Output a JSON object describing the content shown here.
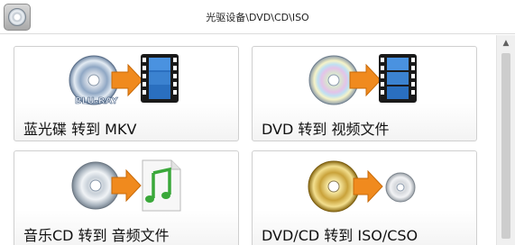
{
  "window": {
    "title": "光驱设备\\DVD\\CD\\ISO"
  },
  "cards": [
    {
      "label": "蓝光碟 转到 MKV",
      "source_icon": "bluray-disc-icon",
      "target_icon": "film-strip-icon",
      "source_badge": "BLU-RAY"
    },
    {
      "label": "DVD 转到 视频文件",
      "source_icon": "dvd-disc-icon",
      "target_icon": "film-strip-icon"
    },
    {
      "label": "音乐CD 转到 音频文件",
      "source_icon": "cd-disc-icon",
      "target_icon": "music-file-icon"
    },
    {
      "label": "DVD/CD 转到 ISO/CSO",
      "source_icon": "gold-disc-icon",
      "target_icon": "iso-disc-icon"
    }
  ],
  "colors": {
    "arrow": "#f08a1e",
    "film": "#2a6fbf",
    "music": "#3aa83a"
  }
}
